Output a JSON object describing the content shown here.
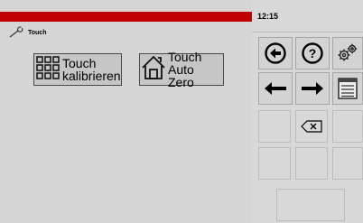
{
  "status": {
    "time": "12:15"
  },
  "header": {
    "icon": "wrench-icon",
    "title": "Touch"
  },
  "actions": [
    {
      "name": "touch-calibrate-button",
      "icon": "grid-icon",
      "label": "Touch\nkalibrieren"
    },
    {
      "name": "touch-auto-zero-button",
      "icon": "home-icon",
      "label": "Touch\nAuto Zero"
    }
  ],
  "keypad": {
    "row1": [
      "back-icon",
      "help-icon",
      "settings-gears-icon"
    ],
    "row2": [
      "arrow-left-icon",
      "arrow-right-icon",
      "document-list-icon"
    ],
    "row3": [
      "",
      "backspace-icon",
      ""
    ],
    "row4": [
      "",
      "",
      ""
    ],
    "row5": [
      ""
    ]
  },
  "colors": {
    "accent_red": "#c00000",
    "background": "#d4d4d4"
  }
}
